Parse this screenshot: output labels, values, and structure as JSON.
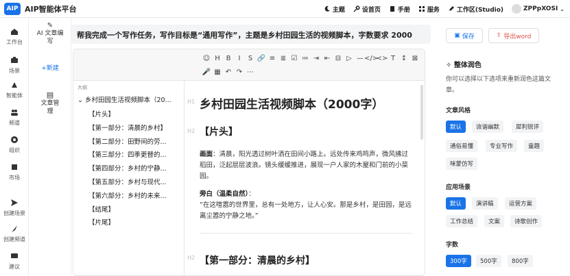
{
  "header": {
    "logo": "AIP",
    "title": "AIP智能体平台",
    "nav": [
      {
        "label": "主题",
        "icon": "moon-icon"
      },
      {
        "label": "设首页",
        "icon": "wrench-icon"
      },
      {
        "label": "手册",
        "icon": "book-icon"
      },
      {
        "label": "服务",
        "icon": "grid-icon"
      },
      {
        "label": "工作区(Studio)",
        "icon": "pen-icon"
      },
      {
        "label": "ZPPpXOSI",
        "icon": "avatar-icon"
      }
    ]
  },
  "sidebar": {
    "items": [
      {
        "label": "工作台",
        "icon": "home-icon"
      },
      {
        "label": "场景",
        "icon": "briefcase-icon"
      },
      {
        "label": "智能体",
        "icon": "robot-icon"
      },
      {
        "label": "频道",
        "icon": "users-icon"
      },
      {
        "label": "组织",
        "icon": "org-icon"
      },
      {
        "label": "市场",
        "icon": "store-icon"
      },
      {
        "label": "创建场景",
        "icon": "send-icon"
      },
      {
        "label": "创建频道",
        "icon": "feather-icon"
      },
      {
        "label": "建议",
        "icon": "message-icon"
      }
    ]
  },
  "col2": {
    "ai_label": "AI 文章编写",
    "new_label": "+新建",
    "doc_label": "文章管理"
  },
  "task": {
    "text": "帮我完成一个写作任务，写作目标是“通用写作”，主题是乡村田园生活的视频脚本，字数要求 2000"
  },
  "toolbar": {
    "row1": [
      "☺",
      "H",
      "B",
      "I",
      "S",
      "🔗",
      "≡",
      "≣",
      "☑",
      "≔",
      "⇥",
      "⇤",
      "⊟",
      "▷",
      "—",
      "</>",
      "<>",
      "T",
      "↕",
      "⊠"
    ],
    "row2": [
      "🎤",
      "▦",
      "↶",
      "↷",
      "⋯"
    ]
  },
  "outline": {
    "title": "大纲",
    "root": "乡村田园生活视频脚本（20...",
    "items": [
      "【片头】",
      "【第一部分：清晨的乡村】",
      "【第二部分：田野间的劳...",
      "【第三部分：四季更替的...",
      "【第四部分：乡村的宁静...",
      "【第五部分：乡村与现代...",
      "【第六部分：乡村的未来...",
      "【结尾】",
      "【片尾】"
    ]
  },
  "doc": {
    "h1_label": "H1",
    "h1": "乡村田园生活视频脚本（2000字）",
    "h2_label_1": "H2",
    "h2_1": "【片头】",
    "p1_label": "画面",
    "p1": "：清晨，阳光透过树叶洒在田间小路上。远处传来鸡鸣声，微风拂过稻田，泛起层层波浪。镜头缓缓推进，展现一户人家的木屋和门前的小菜园。",
    "p2_label": "旁白（温柔自然）",
    "p2_colon": "：",
    "p2": "“在这喧嚣的世界里，总有一处地方，让人心安。那是乡村，是田园，是远离尘嚣的宁静之地。”",
    "h2_label_2": "H2",
    "h2_2": "【第一部分：清晨的乡村】"
  },
  "right": {
    "save_label": "保存",
    "export_label": "导出word",
    "polish_title": "整体润色",
    "polish_desc": "你可以选择以下选项来重新润色这篇文章。",
    "style_title": "文章风格",
    "styles": [
      "默认",
      "诙谐幽默",
      "犀利锐评",
      "通俗易懂",
      "专业写作",
      "童趣",
      "咪蒙仿写"
    ],
    "scene_title": "应用场景",
    "scenes": [
      "默认",
      "演讲稿",
      "运营方案",
      "工作总结",
      "文案",
      "诗歌创作"
    ],
    "words_title": "字数",
    "words": [
      "300字",
      "500字",
      "800字"
    ]
  },
  "colors": {
    "accent": "#1a73e8",
    "danger": "#e0524a"
  }
}
